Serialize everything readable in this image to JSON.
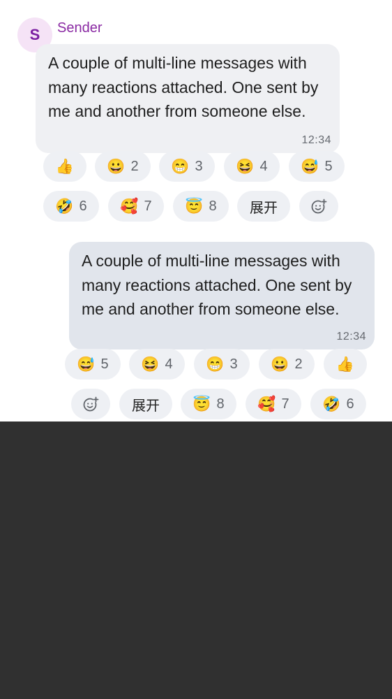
{
  "incoming": {
    "avatar_letter": "S",
    "sender_name": "Sender",
    "text": "A couple of multi-line messages with many reactions attached. One sent by me and another from someone else.",
    "time": "12:34",
    "reactions": [
      {
        "emoji": "👍",
        "count": ""
      },
      {
        "emoji": "😀",
        "count": "2"
      },
      {
        "emoji": "😁",
        "count": "3"
      },
      {
        "emoji": "😆",
        "count": "4"
      },
      {
        "emoji": "😅",
        "count": "5"
      },
      {
        "emoji": "🤣",
        "count": "6"
      },
      {
        "emoji": "🥰",
        "count": "7"
      },
      {
        "emoji": "😇",
        "count": "8"
      }
    ],
    "expand_label": "展开",
    "add_reaction_icon": "add-reaction-icon"
  },
  "outgoing": {
    "text": "A couple of multi-line messages with many reactions attached. One sent by me and another from someone else.",
    "time": "12:34",
    "reactions": [
      {
        "emoji": "😅",
        "count": "5"
      },
      {
        "emoji": "😆",
        "count": "4"
      },
      {
        "emoji": "😁",
        "count": "3"
      },
      {
        "emoji": "😀",
        "count": "2"
      },
      {
        "emoji": "👍",
        "count": ""
      },
      {
        "emoji": "😇",
        "count": "8"
      },
      {
        "emoji": "🥰",
        "count": "7"
      },
      {
        "emoji": "🤣",
        "count": "6"
      }
    ],
    "expand_label": "展开",
    "add_reaction_icon": "add-reaction-icon"
  },
  "colors": {
    "sender_name": "#8a2aa3",
    "incoming_bubble": "#eff0f3",
    "outgoing_bubble": "#e1e5ec",
    "chip_bg": "#eef0f4",
    "background_below": "#303030"
  }
}
